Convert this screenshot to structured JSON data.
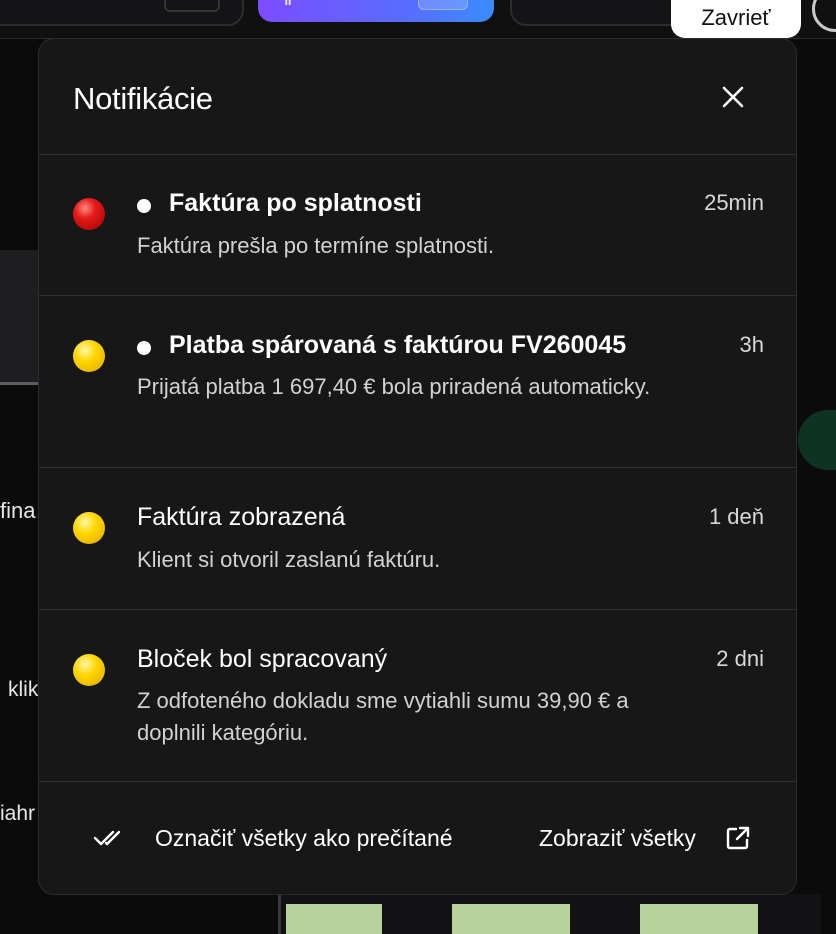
{
  "tooltip": {
    "close_label": "Zavrieť"
  },
  "background": {
    "left_fragments": [
      "fina",
      "klik",
      "iahr"
    ]
  },
  "panel": {
    "title": "Notifikácie",
    "notifications": [
      {
        "title": "Faktúra po splatnosti",
        "body": "Faktúra prešla po termíne splatnosti.",
        "time": "25min",
        "status_color": "#e51a1a",
        "unread": true
      },
      {
        "title": "Platba spárovaná s faktúrou FV260045",
        "body": "Prijatá platba 1 697,40 € bola priradená automaticky.",
        "time": "3h",
        "status_color": "#ffd600",
        "unread": true
      },
      {
        "title": "Faktúra zobrazená",
        "body": "Klient si otvoril zaslanú faktúru.",
        "time": "1 deň",
        "status_color": "#ffd600",
        "unread": false
      },
      {
        "title": "Bloček bol spracovaný",
        "body": "Z odfoteného dokladu sme vytiahli sumu 39,90 € a doplnili kategóriu.",
        "time": "2 dni",
        "status_color": "#ffd600",
        "unread": false
      }
    ],
    "footer": {
      "mark_all_label": "Označiť všetky ako prečítané",
      "view_all_label": "Zobraziť všetky"
    }
  }
}
